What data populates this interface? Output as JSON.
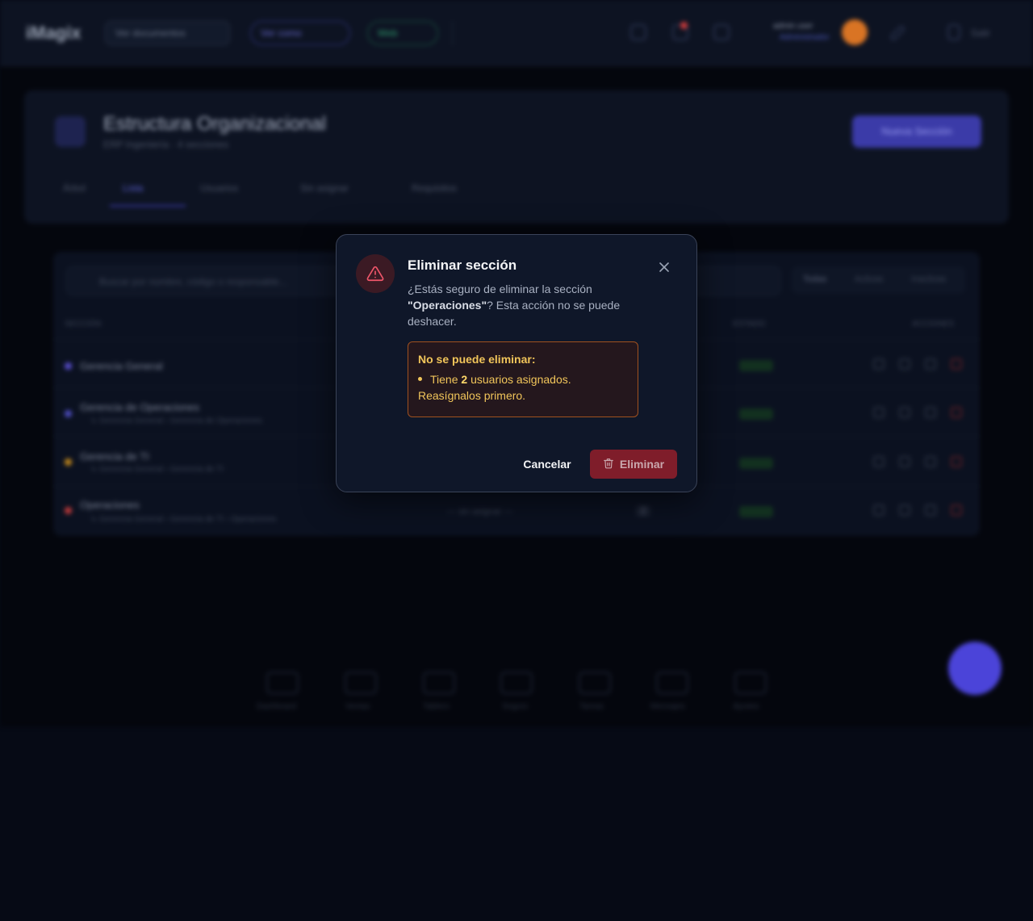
{
  "background": {
    "logo": "iMagix",
    "topbar": {
      "docs_label": "Ver documentos",
      "view_label": "Ver como",
      "web_label": "Web",
      "user_name": "admin user",
      "user_role": "Administrador",
      "logout_label": "Salir"
    },
    "header": {
      "title": "Estructura Organizacional",
      "subtitle": "ERP Ingeniería · 4 secciones",
      "new_button": "Nueva Sección",
      "tabs": [
        "Árbol",
        "Lista",
        "Usuarios",
        "Sin asignar",
        "Requisitos"
      ]
    },
    "table": {
      "search_placeholder": "Buscar por nombre, código o responsable...",
      "filters": [
        "Todas",
        "Activas",
        "Inactivas"
      ],
      "col_section": "SECCIÓN",
      "col_status": "ESTADO",
      "col_actions": "ACCIONES",
      "rows": [
        {
          "title": "Gerencia General",
          "path": "",
          "status": "Activa",
          "color": "#5a4fd1"
        },
        {
          "title": "Gerencia de Operaciones",
          "path": "↳ Gerencia General › Gerencia de Operaciones",
          "status": "Activa",
          "color": "#4f4ec4"
        },
        {
          "title": "Gerencia de TI",
          "path": "↳ Gerencia General › Gerencia de TI",
          "status": "Activa",
          "color": "#c78a1c"
        },
        {
          "title": "Operaciones",
          "path": "↳ Gerencia General › Gerencia de TI › Operaciones",
          "status": "Activa",
          "color": "#c43b3b"
        }
      ],
      "unassigned_label": "— sin asignar —",
      "user_count_label": "2"
    },
    "bottom_nav": [
      "Dashboard",
      "Ventas",
      "Tablero",
      "Seguro",
      "Tareas",
      "Mensajes",
      "Ajustes"
    ]
  },
  "modal": {
    "title": "Eliminar sección",
    "message_prefix": "¿Estás seguro de eliminar la sección",
    "section_name": "\"Operaciones\"",
    "message_suffix": "? Esta acción no se puede deshacer.",
    "error_title": "No se puede eliminar:",
    "error_prefix": "Tiene",
    "error_count": "2",
    "error_suffix": "usuarios asignados. Reasígnalos primero.",
    "cancel_label": "Cancelar",
    "delete_label": "Eliminar"
  },
  "colors": {
    "danger": "#7f1d2a",
    "warning_text": "#f1c55a",
    "warning_border": "#a0511f",
    "accent": "#4b44d9"
  },
  "icons": [
    "alert-triangle-icon",
    "close-icon",
    "trash-icon"
  ]
}
